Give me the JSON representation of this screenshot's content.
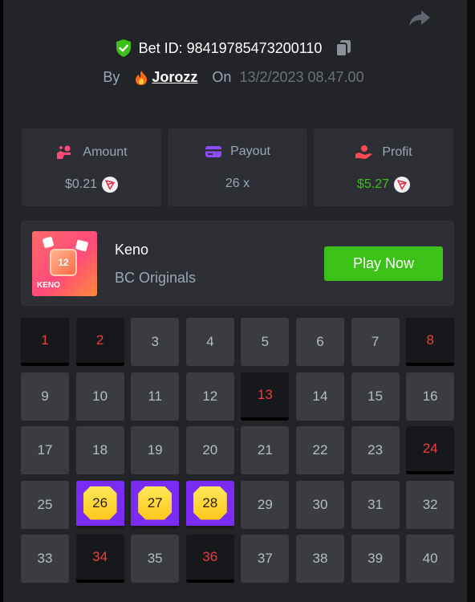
{
  "bet": {
    "id_label": "Bet ID: 98419785473200110",
    "by_label": "By",
    "user_name": "Jorozz",
    "on_label": "On",
    "date": "13/2/2023 08.47.00"
  },
  "stats": {
    "amount": {
      "label": "Amount",
      "value": "$0.21"
    },
    "payout": {
      "label": "Payout",
      "value": "26 x"
    },
    "profit": {
      "label": "Profit",
      "value": "$5.27"
    }
  },
  "game": {
    "name": "Keno",
    "subtitle": "BC Originals",
    "thumb_number": "12",
    "thumb_label": "KENO",
    "play_label": "Play Now"
  },
  "keno": {
    "numbers": [
      "1",
      "2",
      "3",
      "4",
      "5",
      "6",
      "7",
      "8",
      "9",
      "10",
      "11",
      "12",
      "13",
      "14",
      "15",
      "16",
      "17",
      "18",
      "19",
      "20",
      "21",
      "22",
      "23",
      "24",
      "25",
      "26",
      "27",
      "28",
      "29",
      "30",
      "31",
      "32",
      "33",
      "34",
      "35",
      "36",
      "37",
      "38",
      "39",
      "40"
    ],
    "picked": [
      1,
      2,
      8,
      13,
      24,
      34,
      36
    ],
    "hits": [
      26,
      27,
      28
    ]
  },
  "colors": {
    "background": "#232428",
    "card": "#2d2f35",
    "accent_green": "#3bc117",
    "miss_red": "#ed3e3e",
    "hit_purple": "#7b2cf4",
    "gem_yellow": "#ffd42a"
  },
  "icons": {
    "share": "share-icon",
    "shield": "shield-check-icon",
    "copy": "copy-icon",
    "fire": "fire-icon",
    "amount": "bet-amount-icon",
    "payout": "card-icon",
    "profit": "profit-hand-icon",
    "currency": "tron-icon"
  }
}
